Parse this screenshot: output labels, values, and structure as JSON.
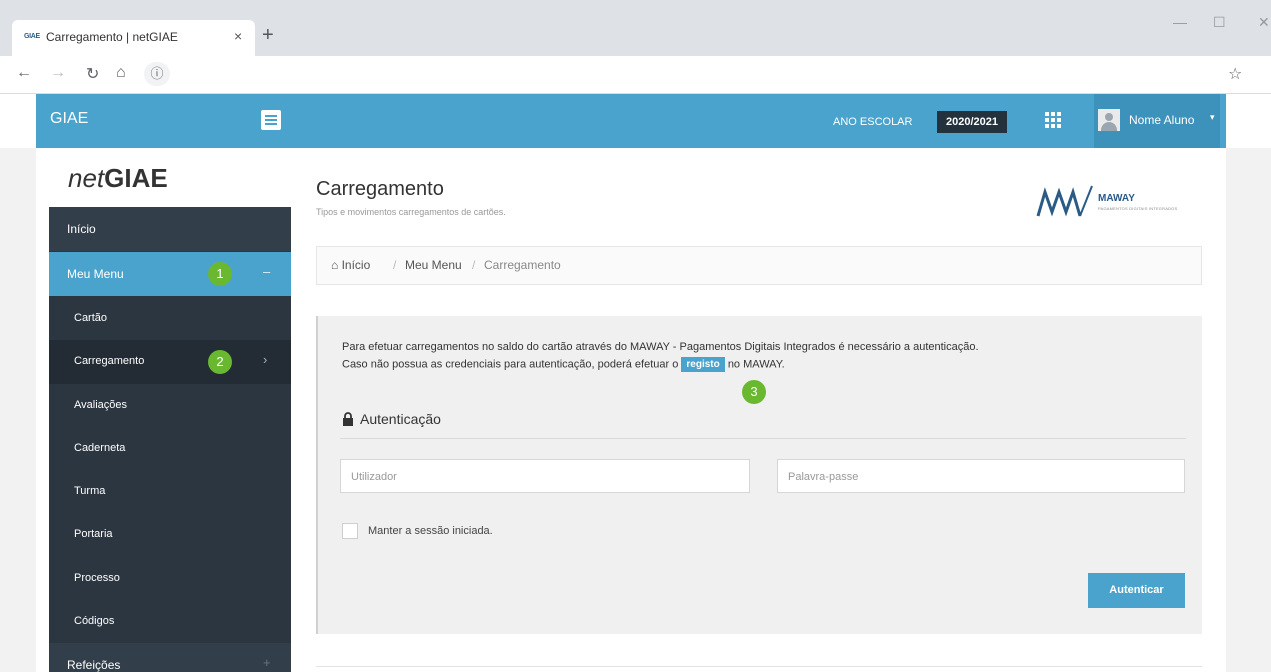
{
  "browser": {
    "tab_title": "Carregamento | netGIAE",
    "tab_favicon_text": "GIAE",
    "tab_close": "×",
    "new_tab": "+",
    "window_min": "—",
    "window_max": "☐",
    "window_close": "✕",
    "info_icon": "ⓘ"
  },
  "topbar": {
    "brand": "GIAE",
    "ano_label": "ANO ESCOLAR",
    "ano_value": "2020/2021",
    "user_name": "Nome Aluno",
    "user_caret": "▾"
  },
  "sidebar": {
    "logo_net": "net",
    "logo_giae": "GIAE",
    "items": [
      {
        "label": "Início"
      },
      {
        "label": "Meu Menu",
        "right": "–",
        "badge": "1"
      },
      {
        "label": "Cartão"
      },
      {
        "label": "Carregamento",
        "right": "›",
        "badge": "2"
      },
      {
        "label": "Avaliações"
      },
      {
        "label": "Caderneta"
      },
      {
        "label": "Turma"
      },
      {
        "label": "Portaria"
      },
      {
        "label": "Processo"
      },
      {
        "label": "Códigos"
      },
      {
        "label": "Refeições",
        "right": "+"
      }
    ]
  },
  "main": {
    "title": "Carregamento",
    "subtitle": "Tipos e movimentos carregamentos de cartões.",
    "maway_brand": "MAWAY",
    "maway_tagline": "PAGAMENTOS DIGITAIS INTEGRADOS",
    "breadcrumb": {
      "home": "Início",
      "separator": "/",
      "menu": "Meu Menu",
      "current": "Carregamento"
    },
    "panel": {
      "line1": "Para efetuar carregamentos no saldo do cartão através do MAWAY - Pagamentos Digitais Integrados é necessário a autenticação.",
      "line2_before": "Caso não possua as credenciais para autenticação, poderá efetuar o",
      "registo": "registo",
      "line2_after": "no MAWAY.",
      "badge": "3",
      "auth_heading": "Autenticação",
      "user_placeholder": "Utilizador",
      "pass_placeholder": "Palavra-passe",
      "keep_session": "Manter a sessão iniciada.",
      "submit": "Autenticar"
    }
  },
  "colors": {
    "accent": "#4aa3cc",
    "sidebar_bg": "#2c3640",
    "badge_green": "#6ab82f",
    "dark_chip": "#23323c"
  }
}
